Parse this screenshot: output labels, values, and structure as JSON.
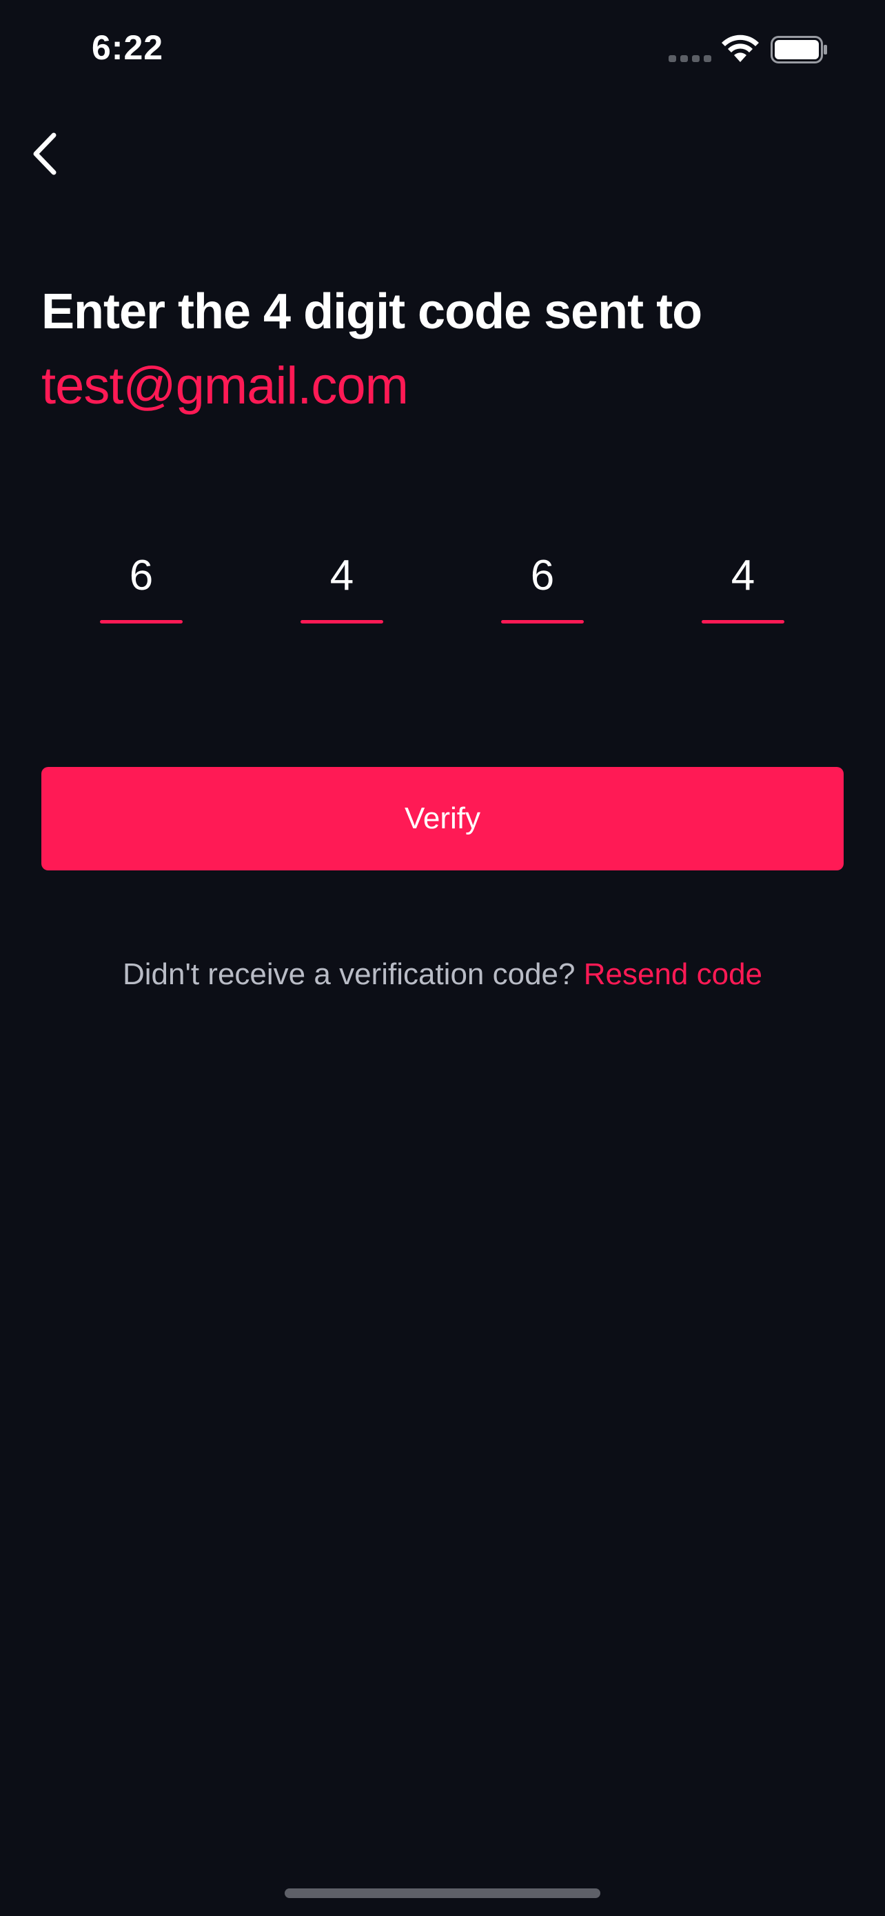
{
  "status_bar": {
    "time": "6:22",
    "icons": [
      "cellular-signal-icon",
      "wifi-icon",
      "battery-icon"
    ]
  },
  "nav": {
    "back_icon": "chevron-left-icon"
  },
  "heading": {
    "title": "Enter the 4 digit code sent to",
    "email": "test@gmail.com"
  },
  "code": {
    "digits": [
      "6",
      "4",
      "6",
      "4"
    ]
  },
  "actions": {
    "verify_label": "Verify"
  },
  "resend": {
    "prompt": "Didn't receive a verification code?",
    "link": "Resend code"
  },
  "colors": {
    "background": "#0c0e16",
    "accent": "#ff1a55",
    "text": "#ffffff",
    "muted_text": "#b9bcc6"
  }
}
